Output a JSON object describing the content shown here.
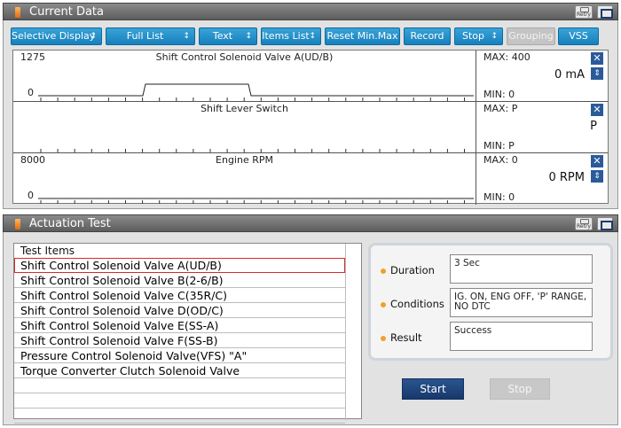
{
  "current_data": {
    "title": "Current Data",
    "retry_label": "Retry",
    "toolbar": [
      {
        "label": "Selective Display",
        "caret": "↕",
        "state": "normal"
      },
      {
        "label": "Full List",
        "caret": "↕",
        "state": "normal"
      },
      {
        "label": "Text",
        "caret": "↕",
        "state": "normal"
      },
      {
        "label": "Items List",
        "caret": "↕",
        "state": "normal"
      },
      {
        "label": "Reset Min.Max",
        "caret": "",
        "state": "normal"
      },
      {
        "label": "Record",
        "caret": "",
        "state": "normal"
      },
      {
        "label": "Stop",
        "caret": "↕",
        "state": "normal"
      },
      {
        "label": "Grouping",
        "caret": "",
        "state": "disabled"
      },
      {
        "label": "VSS",
        "caret": "",
        "state": "normal"
      }
    ],
    "graphs": [
      {
        "title": "Shift Control Solenoid Valve A(UD/B)",
        "ymax_label": "1275",
        "ymin_label": "0",
        "max": "MAX: 400",
        "min": "MIN: 0",
        "value": "0 mA",
        "has_reorder": true,
        "signal": "pulse"
      },
      {
        "title": "Shift Lever Switch",
        "ymax_label": "",
        "ymin_label": "",
        "max": "MAX: P",
        "min": "MIN: P",
        "value": "P",
        "has_reorder": false,
        "signal": "none"
      },
      {
        "title": "Engine RPM",
        "ymax_label": "8000",
        "ymin_label": "0",
        "max": "MAX: 0",
        "min": "MIN: 0",
        "value": "0 RPM",
        "has_reorder": true,
        "signal": "flat"
      }
    ],
    "icons": {
      "close": "close-icon",
      "reorder": "up-down-icon",
      "retry": "retry-icon",
      "window": "window-icon"
    }
  },
  "actuation_test": {
    "title": "Actuation Test",
    "retry_label": "Retry",
    "table_header": "Test Items",
    "items": [
      "Shift Control Solenoid Valve A(UD/B)",
      "Shift Control Solenoid Valve B(2-6/B)",
      "Shift Control Solenoid Valve C(35R/C)",
      "Shift Control Solenoid Valve D(OD/C)",
      "Shift Control Solenoid Valve E(SS-A)",
      "Shift Control Solenoid Valve F(SS-B)",
      "Pressure Control Solenoid Valve(VFS) \"A\"",
      "Torque Converter Clutch Solenoid Valve",
      "",
      "",
      ""
    ],
    "selected_index": 0,
    "info": {
      "duration_label": "Duration",
      "duration_value": "3 Sec",
      "conditions_label": "Conditions",
      "conditions_value": "IG. ON, ENG OFF, 'P' RANGE, NO DTC",
      "result_label": "Result",
      "result_value": "Success"
    },
    "start_label": "Start",
    "stop_label": "Stop"
  },
  "colors": {
    "header_bg": "#6f6f6f",
    "toolbar_blue": "#1f8ccb",
    "start_blue": "#1f4277",
    "selection_red": "#d62b2b",
    "bullet_orange": "#f0a030"
  }
}
